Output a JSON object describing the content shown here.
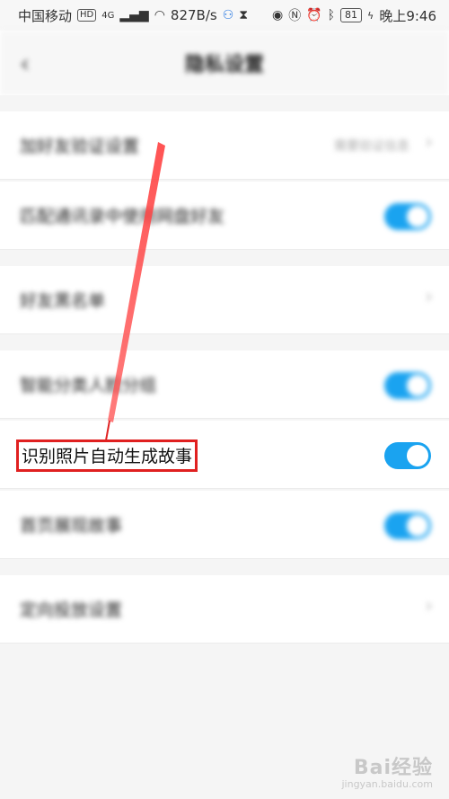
{
  "status_bar": {
    "carrier": "中国移动",
    "hd_badge": "HD",
    "network": "4G",
    "speed": "827B/s",
    "battery": "81",
    "time": "晚上9:46"
  },
  "header": {
    "back_icon": "chevron-left-icon",
    "title": "隐私设置"
  },
  "rows": [
    {
      "label": "加好友验证设置",
      "value": "需要验证信息",
      "type": "chevron"
    },
    {
      "label": "匹配通讯录中使用网盘好友",
      "type": "toggle",
      "checked": true
    },
    {
      "label": "好友黑名单",
      "type": "chevron"
    },
    {
      "label": "智能分类人脸分组",
      "type": "toggle",
      "checked": true
    },
    {
      "label": "识别照片自动生成故事",
      "type": "toggle",
      "checked": true,
      "highlighted": true
    },
    {
      "label": "首页展现故事",
      "type": "toggle",
      "checked": true
    },
    {
      "label": "定向投放设置",
      "type": "chevron"
    }
  ],
  "colors": {
    "toggle_on": "#1aa3f0",
    "highlight": "#e02020"
  },
  "watermark": {
    "logo": "Bai经验",
    "url": "jingyan.baidu.com"
  }
}
